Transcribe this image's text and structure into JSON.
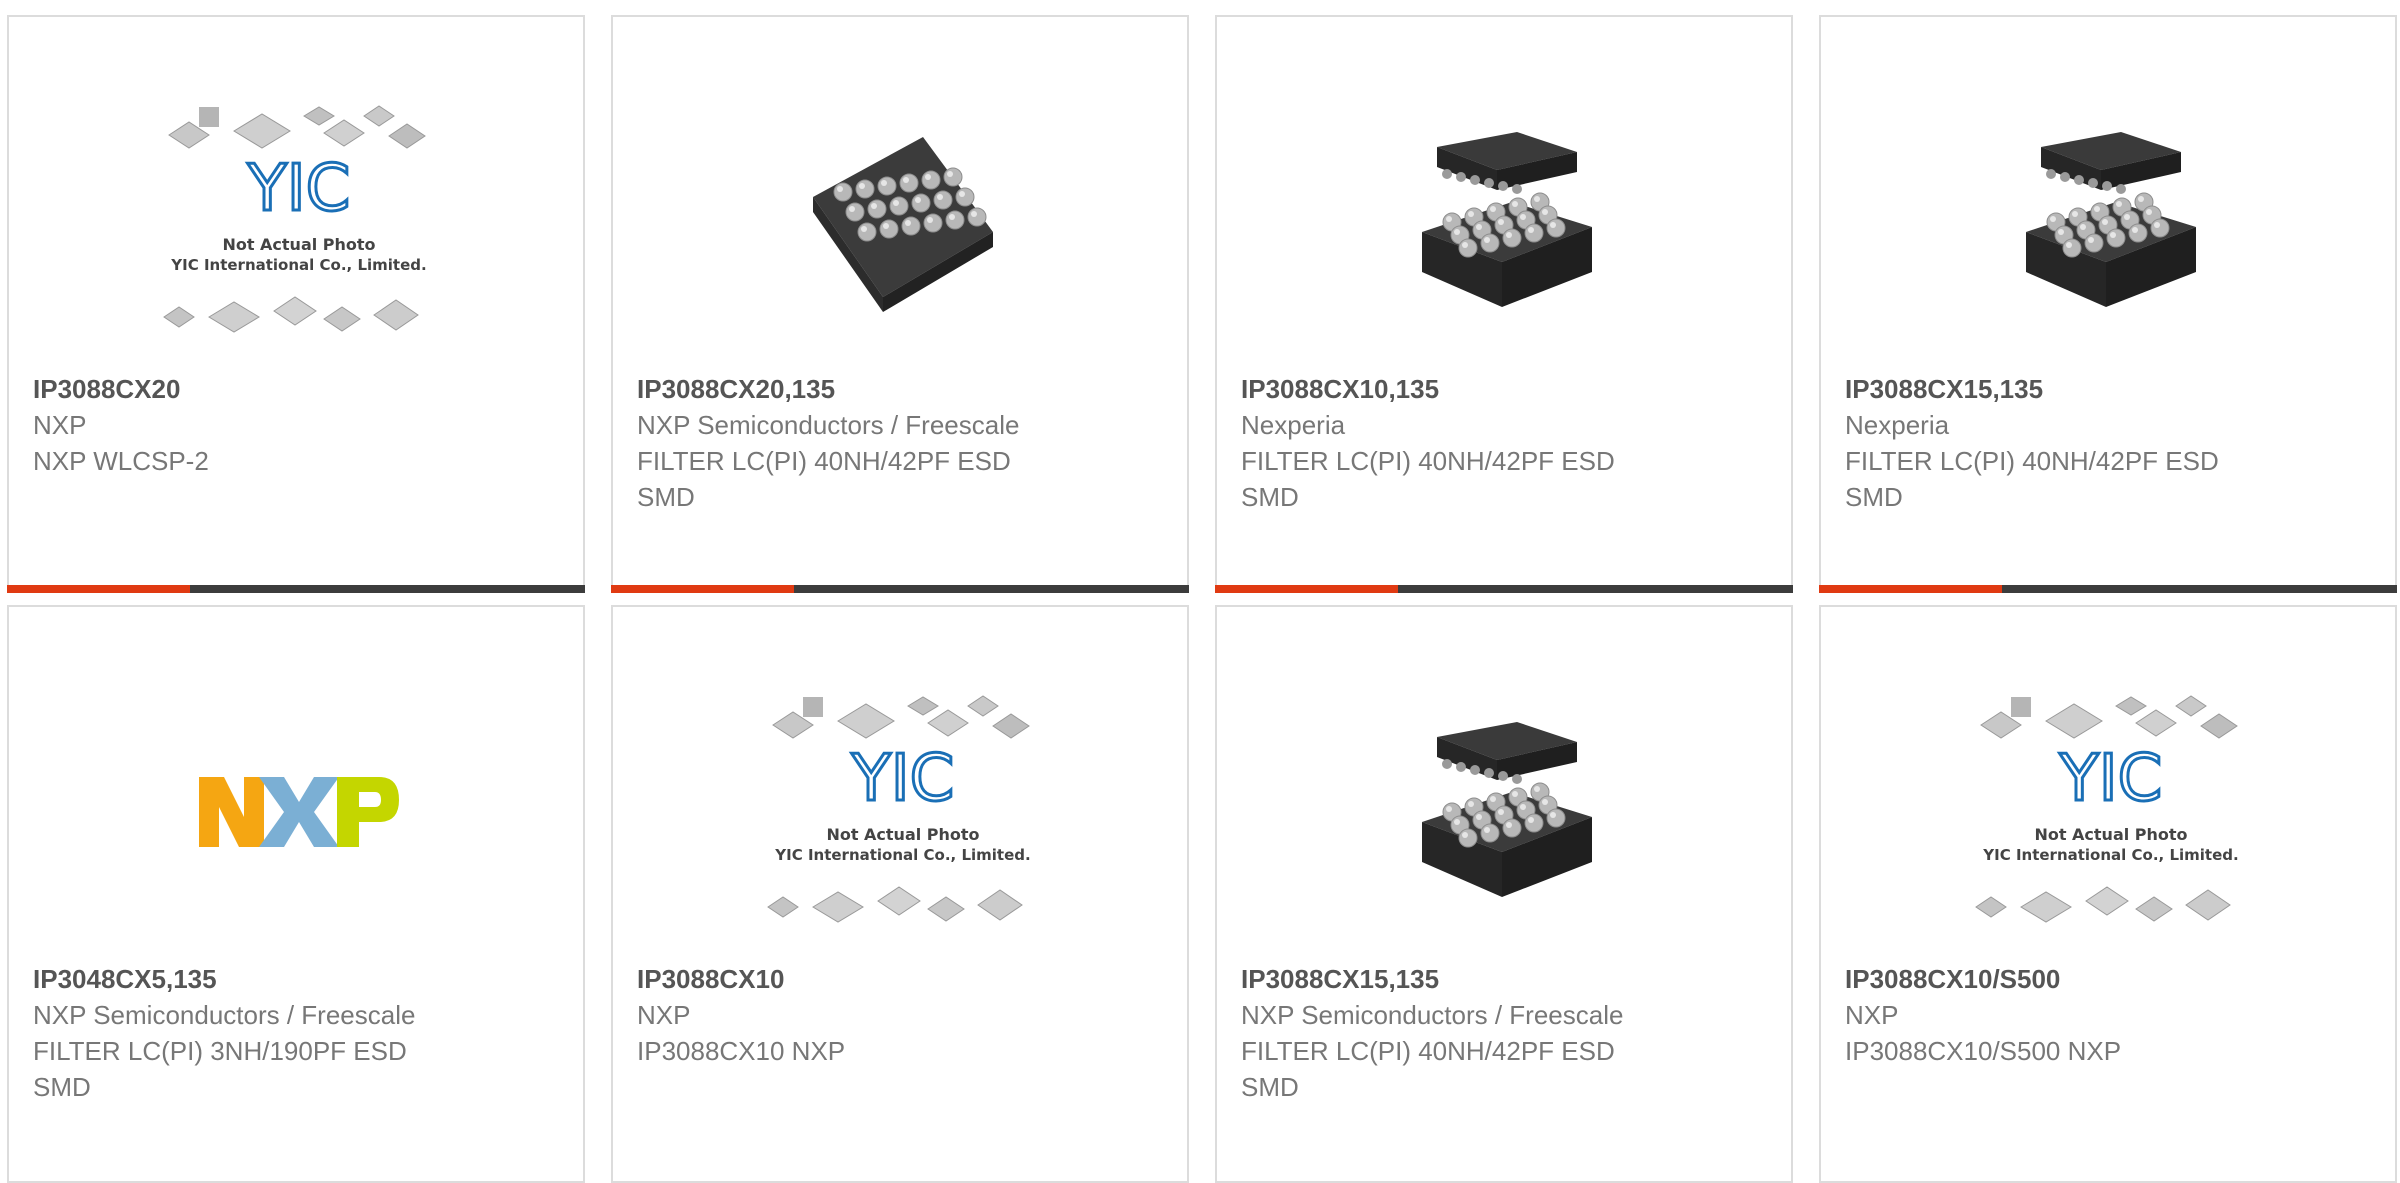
{
  "colors": {
    "bar_accent": "#e03a12",
    "bar_dark": "#3c3c3c",
    "border": "#dcdcdc",
    "title_text": "#555555",
    "body_text": "#777777"
  },
  "products": [
    {
      "part_number": "IP3088CX20",
      "manufacturer": "NXP",
      "description": "NXP WLCSP-2",
      "image_kind": "placeholder",
      "image_text": {
        "line1": "Not Actual Photo",
        "line2": "YIC International Co., Limited.",
        "logo": "YIC"
      },
      "has_bar": true
    },
    {
      "part_number": "IP3088CX20,135",
      "manufacturer": "NXP Semiconductors / Freescale",
      "description": "FILTER LC(PI) 40NH/42PF ESD\nSMD",
      "image_kind": "chip-flat",
      "has_bar": true
    },
    {
      "part_number": "IP3088CX10,135",
      "manufacturer": "Nexperia",
      "description": "FILTER LC(PI) 40NH/42PF ESD\nSMD",
      "image_kind": "chip-pair",
      "has_bar": true
    },
    {
      "part_number": "IP3088CX15,135",
      "manufacturer": "Nexperia",
      "description": "FILTER LC(PI) 40NH/42PF ESD\nSMD",
      "image_kind": "chip-pair",
      "has_bar": true
    },
    {
      "part_number": "IP3048CX5,135",
      "manufacturer": "NXP Semiconductors / Freescale",
      "description": "FILTER LC(PI) 3NH/190PF ESD\nSMD",
      "image_kind": "nxp-logo",
      "image_text": {
        "logo": "NXP"
      },
      "has_bar": false
    },
    {
      "part_number": "IP3088CX10",
      "manufacturer": "NXP",
      "description": "IP3088CX10 NXP",
      "image_kind": "placeholder",
      "image_text": {
        "line1": "Not Actual Photo",
        "line2": "YIC International Co., Limited.",
        "logo": "YIC"
      },
      "has_bar": false
    },
    {
      "part_number": "IP3088CX15,135",
      "manufacturer": "NXP Semiconductors / Freescale",
      "description": "FILTER LC(PI) 40NH/42PF ESD\nSMD",
      "image_kind": "chip-pair",
      "has_bar": false
    },
    {
      "part_number": "IP3088CX10/S500",
      "manufacturer": "NXP",
      "description": "IP3088CX10/S500 NXP",
      "image_kind": "placeholder",
      "image_text": {
        "line1": "Not Actual Photo",
        "line2": "YIC International Co., Limited.",
        "logo": "YIC"
      },
      "has_bar": false
    }
  ]
}
